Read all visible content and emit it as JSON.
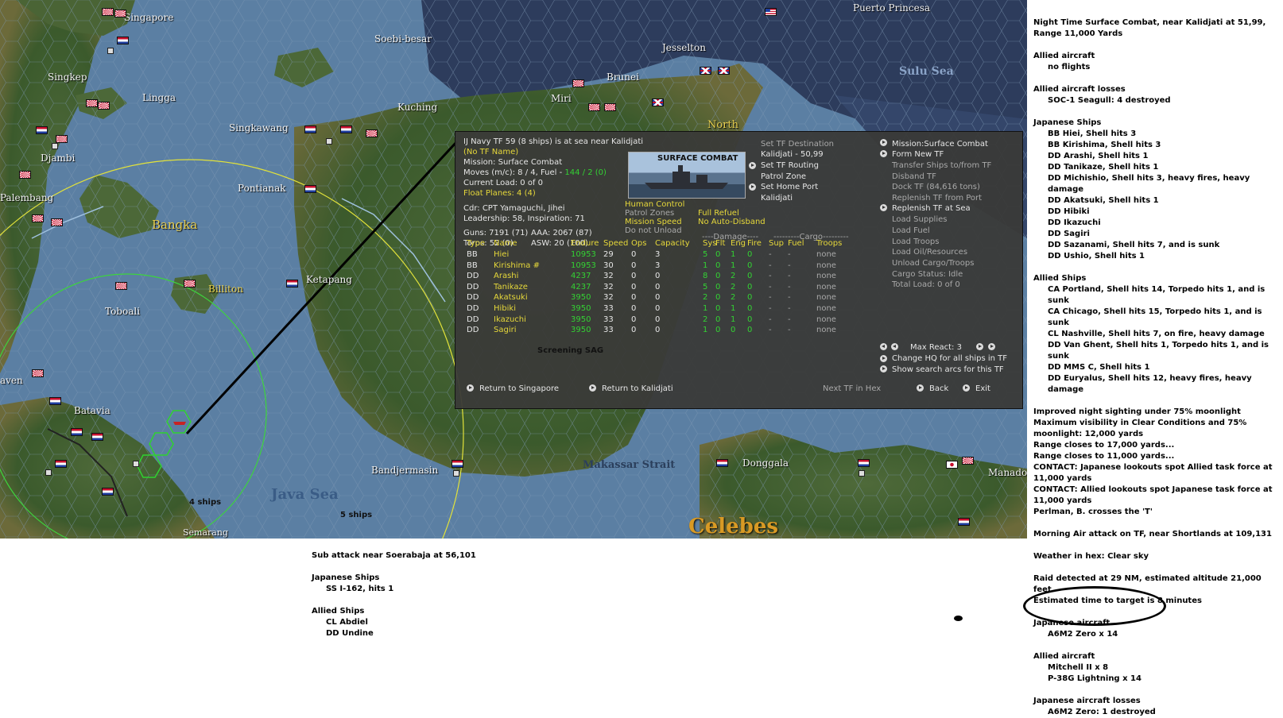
{
  "map": {
    "labels": {
      "singapore": "Singapore",
      "soebi_besar": "Soebi-besar",
      "jesselton": "Jesselton",
      "puerto_princesa": "Puerto Princesa",
      "sulu_sea": "Sulu Sea",
      "singkep": "Singkep",
      "lingga": "Lingga",
      "brunei": "Brunei",
      "kuching": "Kuching",
      "miri": "Miri",
      "singkawang": "Singkawang",
      "north": "North",
      "djambi": "Djambi",
      "palembang": "Palembang",
      "pontianak": "Pontianak",
      "bangka": "Bangka",
      "billiton": "Billiton",
      "ketapang": "Ketapang",
      "toboali": "Toboali",
      "batavia": "Batavia",
      "java_sea": "Java Sea",
      "bandjermasin": "Bandjermasin",
      "makassar_strait": "Makassar Strait",
      "donggala": "Donggala",
      "manado": "Manado",
      "celebes": "Celebes",
      "semarang": "Semarang",
      "raven": "aven"
    },
    "fleet_labels": {
      "four_ships": "4 ships",
      "five_ships": "5 ships"
    }
  },
  "panel": {
    "header": {
      "title": "IJ Navy TF 59 (8 ships) is at sea near Kalidjati",
      "tf_name": "(No TF Name)",
      "mission": "Mission: Surface Combat",
      "moves_prefix": "Moves (m/c): 8 / 4, Fuel - ",
      "moves_fuel": "144 / 2 (0)",
      "current_load": "Current Load: 0 of 0",
      "float_planes": "Float Planes: 4 (4)",
      "commander": "Cdr: CPT Yamaguchi, Jihei",
      "leadership": "Leadership: 58, Inspiration: 71",
      "guns": "Guns: 7191 (71)",
      "aaa": "AAA: 2067 (87)",
      "torps": "Torps: 52 (0)",
      "asw": "ASW: 20 (100)"
    },
    "image_title": "SURFACE COMBAT",
    "status": {
      "human_control": "Human Control",
      "patrol_zones": "Patrol Zones",
      "mission_speed": "Mission Speed",
      "do_not_unload": "Do not Unload",
      "full_refuel": "Full Refuel",
      "no_auto_disband": "No Auto-Disband"
    },
    "destination": {
      "set_tf_destination": "Set TF Destination",
      "destination_value": "Kalidjati - 50,99",
      "set_tf_routing": "Set TF Routing",
      "patrol_zone": "Patrol Zone",
      "set_home_port": "Set Home Port",
      "home_port_value": "Kalidjati"
    },
    "commands": {
      "mission_surface_combat": "Mission:Surface Combat",
      "form_new_tf": "Form New TF",
      "transfer_ships": "Transfer Ships to/from TF",
      "disband_tf": "Disband TF",
      "dock_tf": "Dock TF (84,616 tons)",
      "replenish_from_port": "Replenish TF from Port",
      "replenish_at_sea": "Replenish TF at Sea",
      "load_supplies": "Load Supplies",
      "load_fuel": "Load Fuel",
      "load_troops": "Load Troops",
      "load_oil": "Load Oil/Resources",
      "unload_cargo": "Unload Cargo/Troops",
      "cargo_status": "Cargo Status: Idle",
      "total_load": "Total Load: 0 of 0"
    },
    "table": {
      "group_damage": "----Damage----",
      "group_cargo": "---------Cargo---------",
      "headers": [
        "Type",
        "Name",
        "Endure",
        "Speed",
        "Ops",
        "Capacity",
        "Sys",
        "Flt",
        "Eng",
        "Fire",
        "Sup",
        "Fuel",
        "Troops"
      ],
      "rows": [
        [
          "BB",
          "Hiei",
          "10953",
          "29",
          "0",
          "3",
          "5",
          "0",
          "1",
          "0",
          "-",
          "-",
          "none"
        ],
        [
          "BB",
          "Kirishima #",
          "10953",
          "30",
          "0",
          "3",
          "1",
          "0",
          "1",
          "0",
          "-",
          "-",
          "none"
        ],
        [
          "DD",
          "Arashi",
          "4237",
          "32",
          "0",
          "0",
          "8",
          "0",
          "2",
          "0",
          "-",
          "-",
          "none"
        ],
        [
          "DD",
          "Tanikaze",
          "4237",
          "32",
          "0",
          "0",
          "5",
          "0",
          "2",
          "0",
          "-",
          "-",
          "none"
        ],
        [
          "DD",
          "Akatsuki",
          "3950",
          "32",
          "0",
          "0",
          "2",
          "0",
          "2",
          "0",
          "-",
          "-",
          "none"
        ],
        [
          "DD",
          "Hibiki",
          "3950",
          "33",
          "0",
          "0",
          "1",
          "0",
          "1",
          "0",
          "-",
          "-",
          "none"
        ],
        [
          "DD",
          "Ikazuchi",
          "3950",
          "33",
          "0",
          "0",
          "2",
          "0",
          "1",
          "0",
          "-",
          "-",
          "none"
        ],
        [
          "DD",
          "Sagiri",
          "3950",
          "33",
          "0",
          "0",
          "1",
          "0",
          "0",
          "0",
          "-",
          "-",
          "none"
        ]
      ]
    },
    "screening": "Screening SAG",
    "max_react": "Max React: 3",
    "change_hq": "Change HQ for all ships in TF",
    "show_arcs": "Show search arcs for this TF",
    "return_singapore": "Return to Singapore",
    "return_kalidjati": "Return to Kalidjati",
    "next_tf": "Next TF in Hex",
    "back": "Back",
    "exit": "Exit"
  },
  "combat_log": [
    {
      "text": "Night Time Surface Combat, near Kalidjati at 51,99, Range 11,000 Yards",
      "indent": false
    },
    {
      "text": "",
      "indent": false
    },
    {
      "text": "Allied aircraft",
      "indent": false
    },
    {
      "text": "no flights",
      "indent": true
    },
    {
      "text": "",
      "indent": false
    },
    {
      "text": "Allied aircraft losses",
      "indent": false
    },
    {
      "text": "SOC-1 Seagull: 4 destroyed",
      "indent": true
    },
    {
      "text": "",
      "indent": false
    },
    {
      "text": "Japanese Ships",
      "indent": false
    },
    {
      "text": "BB Hiei, Shell hits 3",
      "indent": true
    },
    {
      "text": "BB Kirishima, Shell hits 3",
      "indent": true
    },
    {
      "text": "DD Arashi, Shell hits 1",
      "indent": true
    },
    {
      "text": "DD Tanikaze, Shell hits 1",
      "indent": true
    },
    {
      "text": "DD Michishio, Shell hits 3,  heavy fires,  heavy damage",
      "indent": true
    },
    {
      "text": "DD Akatsuki, Shell hits 1",
      "indent": true
    },
    {
      "text": "DD Hibiki",
      "indent": true
    },
    {
      "text": "DD Ikazuchi",
      "indent": true
    },
    {
      "text": "DD Sagiri",
      "indent": true
    },
    {
      "text": "DD Sazanami, Shell hits 7, and is sunk",
      "indent": true
    },
    {
      "text": "DD Ushio, Shell hits 1",
      "indent": true
    },
    {
      "text": "",
      "indent": false
    },
    {
      "text": "Allied Ships",
      "indent": false
    },
    {
      "text": "CA Portland, Shell hits 14, Torpedo hits 1, and is sunk",
      "indent": true
    },
    {
      "text": "CA Chicago, Shell hits 15, Torpedo hits 1, and is sunk",
      "indent": true
    },
    {
      "text": "CL Nashville, Shell hits 7,  on fire,  heavy damage",
      "indent": true
    },
    {
      "text": "DD Van Ghent, Shell hits 1, Torpedo hits 1, and is sunk",
      "indent": true
    },
    {
      "text": "DD MMS C, Shell hits 1",
      "indent": true
    },
    {
      "text": "DD Euryalus, Shell hits 12,  heavy fires,  heavy damage",
      "indent": true
    },
    {
      "text": "",
      "indent": false
    },
    {
      "text": "Improved night sighting under 75% moonlight",
      "indent": false
    },
    {
      "text": "Maximum visibility in Clear Conditions and 75% moonlight: 12,000 yards",
      "indent": false
    },
    {
      "text": "Range closes to 17,000 yards...",
      "indent": false
    },
    {
      "text": "Range closes to 11,000 yards...",
      "indent": false
    },
    {
      "text": "CONTACT: Japanese lookouts spot Allied task force at 11,000 yards",
      "indent": false
    },
    {
      "text": "CONTACT: Allied lookouts spot Japanese task force at 11,000 yards",
      "indent": false
    },
    {
      "text": "Perlman, B. crosses the 'T'",
      "indent": false
    },
    {
      "text": "",
      "indent": false
    },
    {
      "text": "Morning Air attack on TF, near Shortlands at 109,131",
      "indent": false
    },
    {
      "text": "",
      "indent": false
    },
    {
      "text": "Weather in hex: Clear sky",
      "indent": false
    },
    {
      "text": "",
      "indent": false
    },
    {
      "text": "Raid detected at 29 NM, estimated altitude 21,000 feet.",
      "indent": false
    },
    {
      "text": "Estimated time to target is 8 minutes",
      "indent": false
    },
    {
      "text": "",
      "indent": false
    },
    {
      "text": "Japanese aircraft",
      "indent": false
    },
    {
      "text": "A6M2 Zero x 14",
      "indent": true
    },
    {
      "text": "",
      "indent": false
    },
    {
      "text": "Allied aircraft",
      "indent": false
    },
    {
      "text": "Mitchell II x 8",
      "indent": true
    },
    {
      "text": "P-38G Lightning x 14",
      "indent": true
    },
    {
      "text": "",
      "indent": false
    },
    {
      "text": "Japanese aircraft losses",
      "indent": false
    },
    {
      "text": "A6M2 Zero: 1 destroyed",
      "indent": true
    }
  ],
  "sub_log": [
    {
      "text": "Sub attack near Soerabaja  at 56,101",
      "indent": false
    },
    {
      "text": "",
      "indent": false
    },
    {
      "text": "Japanese Ships",
      "indent": false
    },
    {
      "text": "SS I-162, hits 1",
      "indent": true
    },
    {
      "text": "",
      "indent": false
    },
    {
      "text": "Allied Ships",
      "indent": false
    },
    {
      "text": "CL Abdiel",
      "indent": true
    },
    {
      "text": "DD Undine",
      "indent": true
    }
  ]
}
